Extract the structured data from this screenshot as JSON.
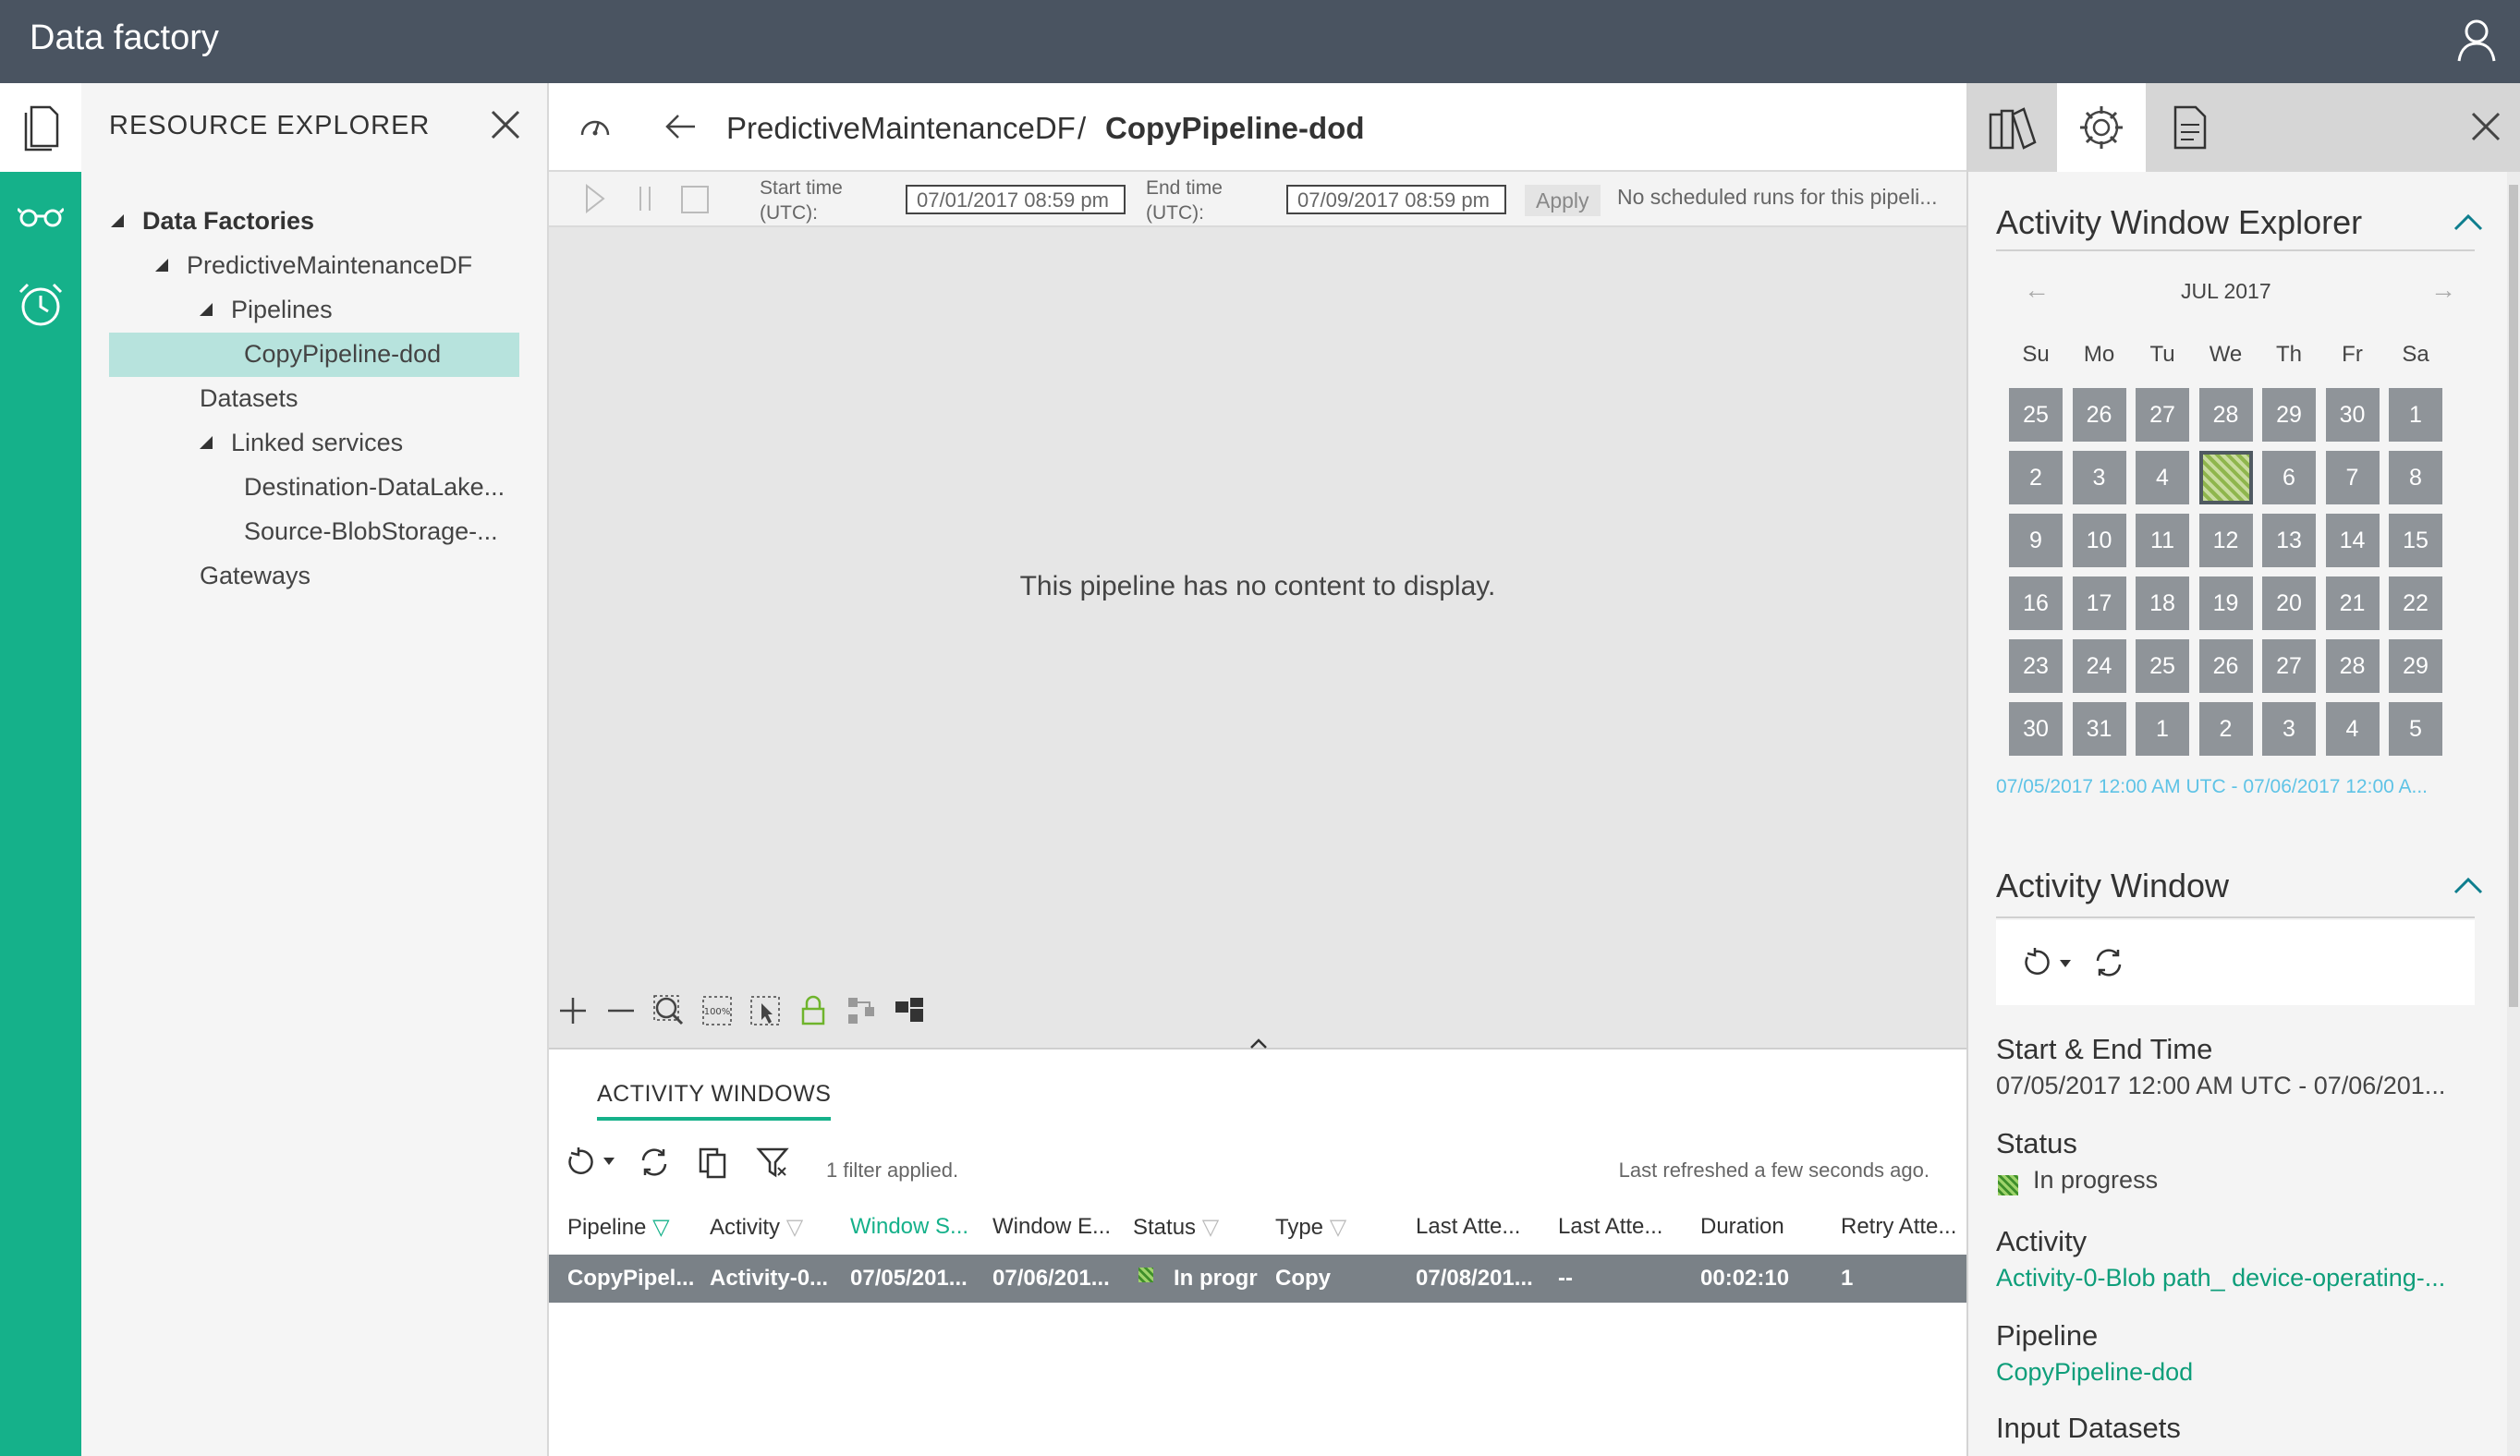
{
  "app": {
    "title": "Data factory"
  },
  "explorer": {
    "title": "RESOURCE EXPLORER",
    "tree": {
      "root": "Data Factories",
      "factory": "PredictiveMaintenanceDF",
      "pipelines": "Pipelines",
      "pipeline": "CopyPipeline-dod",
      "datasets": "Datasets",
      "linked_services": "Linked services",
      "ls1": "Destination-DataLake...",
      "ls2": "Source-BlobStorage-...",
      "gateways": "Gateways"
    }
  },
  "breadcrumb": {
    "factory": "PredictiveMaintenanceDF",
    "separator": "/",
    "pipeline": "CopyPipeline-dod"
  },
  "runbar": {
    "start_label_1": "Start time",
    "start_label_2": "(UTC):",
    "start_value": "07/01/2017 08:59 pm",
    "end_label_1": "End time",
    "end_label_2": "(UTC):",
    "end_value": "07/09/2017 08:59 pm",
    "apply": "Apply",
    "status": "No scheduled runs for this pipeli..."
  },
  "canvas": {
    "message": "This pipeline has no content to display."
  },
  "activity_windows": {
    "title": "ACTIVITY WINDOWS",
    "filters": "1 filter applied.",
    "refreshed": "Last refreshed a few seconds ago.",
    "columns": [
      "Pipeline",
      "Activity",
      "Window S...",
      "Window E...",
      "Status",
      "Type",
      "Last Atte...",
      "Last Atte...",
      "Duration",
      "Retry Atte..."
    ],
    "row": {
      "pipeline": "CopyPipel...",
      "activity": "Activity-0...",
      "window_start": "07/05/201...",
      "window_end": "07/06/201...",
      "status": "In progr",
      "type": "Copy",
      "last_attempt_start": "07/08/201...",
      "last_attempt_end": "--",
      "duration": "00:02:10",
      "retry": "1"
    }
  },
  "right_panel": {
    "awe_title": "Activity Window Explorer",
    "calendar": {
      "month": "JUL 2017",
      "prev": "←",
      "next": "→",
      "dow": [
        "Su",
        "Mo",
        "Tu",
        "We",
        "Th",
        "Fr",
        "Sa"
      ],
      "weeks": [
        [
          "25",
          "26",
          "27",
          "28",
          "29",
          "30",
          "1"
        ],
        [
          "2",
          "3",
          "4",
          "",
          "6",
          "7",
          "8"
        ],
        [
          "9",
          "10",
          "11",
          "12",
          "13",
          "14",
          "15"
        ],
        [
          "16",
          "17",
          "18",
          "19",
          "20",
          "21",
          "22"
        ],
        [
          "23",
          "24",
          "25",
          "26",
          "27",
          "28",
          "29"
        ],
        [
          "30",
          "31",
          "1",
          "2",
          "3",
          "4",
          "5"
        ]
      ],
      "range": "07/05/2017 12:00 AM UTC - 07/06/2017 12:00 A..."
    },
    "aw_title": "Activity Window",
    "props": {
      "time_label": "Start & End Time",
      "time_value": "07/05/2017 12:00 AM UTC - 07/06/201...",
      "status_label": "Status",
      "status_value": "In progress",
      "activity_label": "Activity",
      "activity_value": "Activity-0-Blob path_ device-operating-...",
      "pipeline_label": "Pipeline",
      "pipeline_value": "CopyPipeline-dod",
      "input_label": "Input Datasets"
    }
  },
  "colors": {
    "topbar": "#4a5461",
    "accent": "#15b18a",
    "link": "#0e9e7a",
    "selected_row": "#7a8187"
  }
}
